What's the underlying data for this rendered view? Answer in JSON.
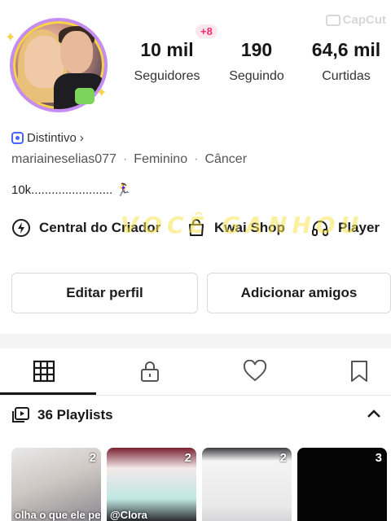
{
  "watermark": {
    "text": "CapCut",
    "icon": "capcut-logo"
  },
  "profile": {
    "notification_badge": "+8",
    "stats": [
      {
        "value": "10 mil",
        "label": "Seguidores"
      },
      {
        "value": "190",
        "label": "Seguindo"
      },
      {
        "value": "64,6 mil",
        "label": "Curtidas"
      }
    ],
    "badge_label": "Distintivo",
    "badge_chevron": "›",
    "username": "mariaineselias077",
    "gender": "Feminino",
    "sign": "Câncer",
    "separator": "·",
    "bio": "10k........................ 🏃‍♀️"
  },
  "links": {
    "creator_center": "Central do Criador",
    "shop": "Kwai Shop",
    "player": "Player"
  },
  "overlay_text": "VOCÊ GANHOU",
  "buttons": {
    "edit_profile": "Editar perfil",
    "add_friends": "Adicionar amigos"
  },
  "tabs": [
    {
      "name": "grid",
      "icon": "grid-icon",
      "active": true
    },
    {
      "name": "private",
      "icon": "lock-icon",
      "active": false
    },
    {
      "name": "likes",
      "icon": "heart-icon",
      "active": false
    },
    {
      "name": "saved",
      "icon": "bookmark-icon",
      "active": false
    }
  ],
  "playlists": {
    "label": "36 Playlists",
    "items": [
      {
        "count": "2",
        "caption": "olha o que ele perdeu"
      },
      {
        "count": "2",
        "caption": "@Clora"
      },
      {
        "count": "2",
        "caption": ""
      },
      {
        "count": "3",
        "caption": ""
      }
    ]
  },
  "colors": {
    "accent_pink": "#ff2b6a",
    "badge_blue": "#4a66ff",
    "avatar_ring": "#c58cf2"
  }
}
